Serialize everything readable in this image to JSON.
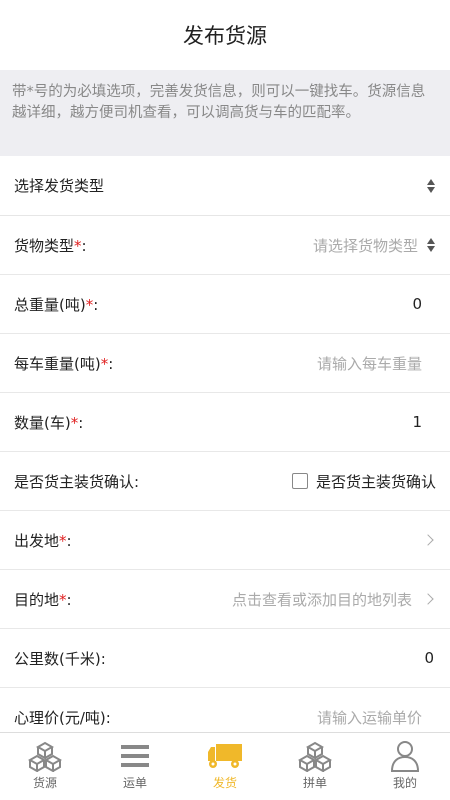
{
  "header": {
    "title": "发布货源"
  },
  "notice": {
    "text": "带*号的为必填选项，完善发货信息，则可以一键找车。货源信息越详细，越方便司机查看，可以调高货与车的匹配率。"
  },
  "select_type": {
    "label": "选择发货类型"
  },
  "form": {
    "cargo_type": {
      "label": "货物类型",
      "star": "*",
      "colon": ":",
      "placeholder": "请选择货物类型"
    },
    "total_weight": {
      "label": "总重量(吨)",
      "star": "*",
      "colon": ":",
      "value": "0"
    },
    "weight_per_truck": {
      "label": "每车重量(吨)",
      "star": "*",
      "colon": ":",
      "placeholder": "请输入每车重量"
    },
    "quantity": {
      "label": "数量(车)",
      "star": "*",
      "colon": ":",
      "value": "1"
    },
    "owner_confirm": {
      "label": "是否货主装货确认:",
      "checkbox_label": "是否货主装货确认"
    },
    "origin": {
      "label": "出发地",
      "star": "*",
      "colon": ":"
    },
    "destination": {
      "label": "目的地",
      "star": "*",
      "colon": ":",
      "placeholder": "点击查看或添加目的地列表"
    },
    "distance": {
      "label": "公里数(千米):",
      "value": "0"
    },
    "price": {
      "label": "心理价(元/吨):",
      "placeholder": "请输入运输单价"
    }
  },
  "tabbar": {
    "items": [
      {
        "label": "货源",
        "icon": "cubes-icon"
      },
      {
        "label": "运单",
        "icon": "list-icon"
      },
      {
        "label": "发货",
        "icon": "truck-icon",
        "active": true
      },
      {
        "label": "拼单",
        "icon": "cubes-icon"
      },
      {
        "label": "我的",
        "icon": "user-icon"
      }
    ]
  },
  "colors": {
    "accent": "#f0b82a",
    "required": "#e02020",
    "placeholder": "#aaaaaa"
  }
}
